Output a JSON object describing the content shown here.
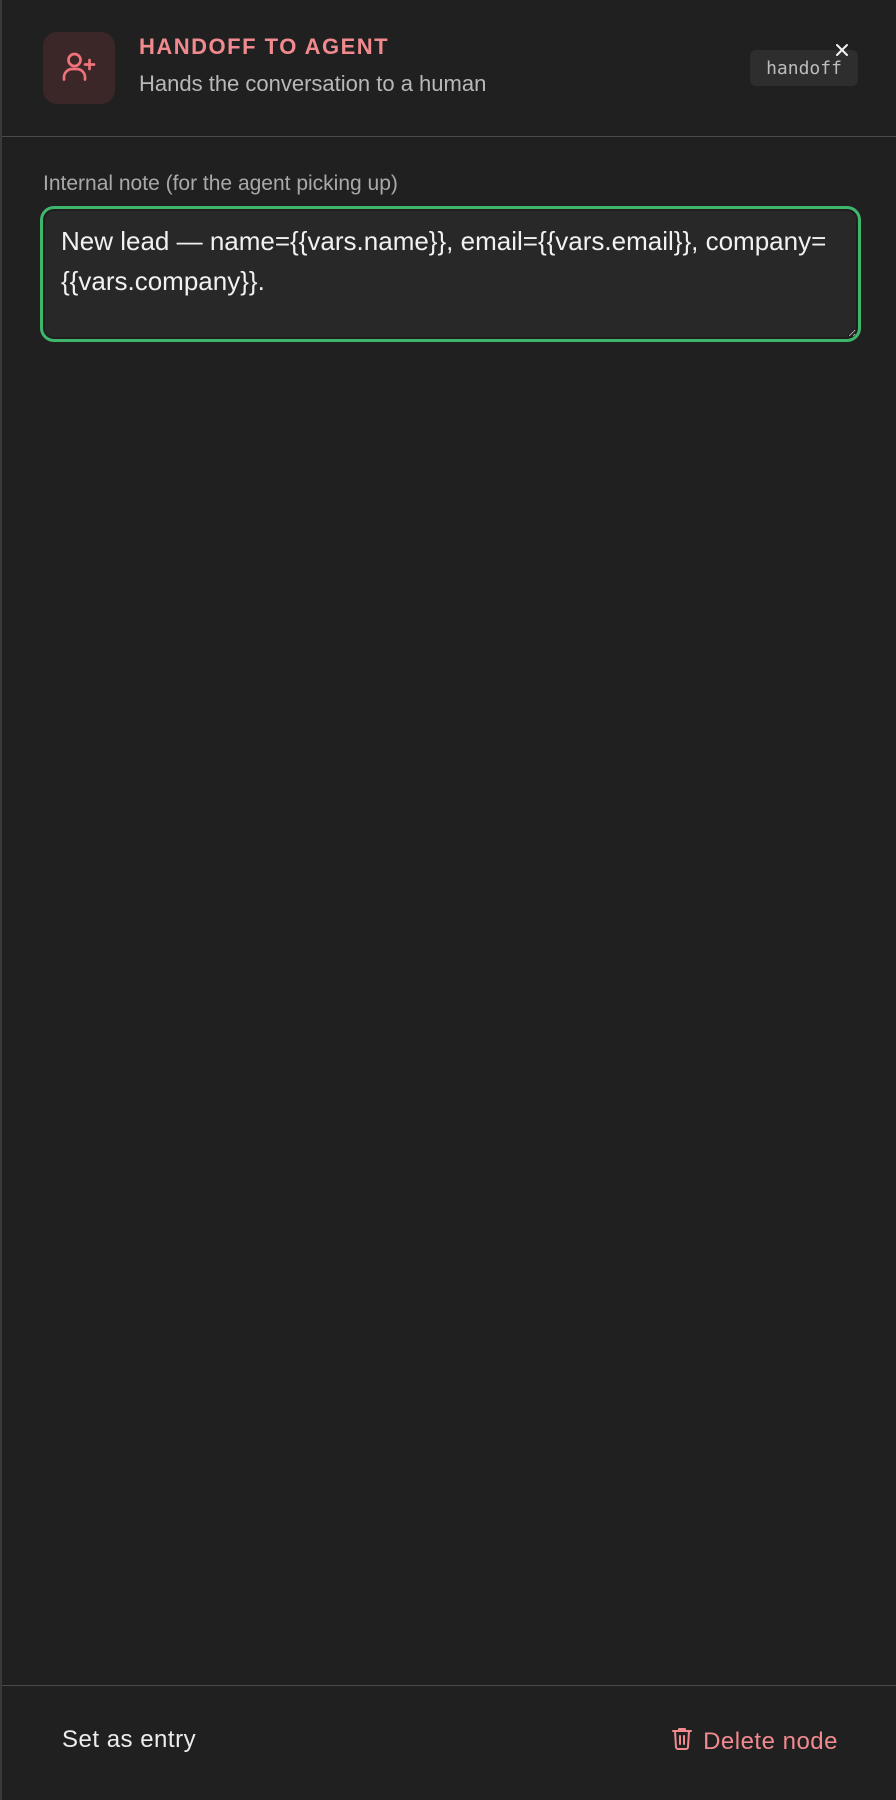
{
  "header": {
    "icon": "user-plus-icon",
    "title": "HANDOFF TO AGENT",
    "subtitle": "Hands the conversation to a human",
    "type_badge": "handoff",
    "close_icon": "close-icon"
  },
  "note": {
    "label": "Internal note (for the agent picking up)",
    "value": "New lead — name={{vars.name}}, email={{vars.email}}, company={{vars.company}}."
  },
  "footer": {
    "set_entry_label": "Set as entry",
    "delete_label": "Delete node",
    "delete_icon": "trash-icon"
  },
  "colors": {
    "accent": "#f08a8f",
    "focus": "#3fb66c",
    "background": "#202020"
  }
}
